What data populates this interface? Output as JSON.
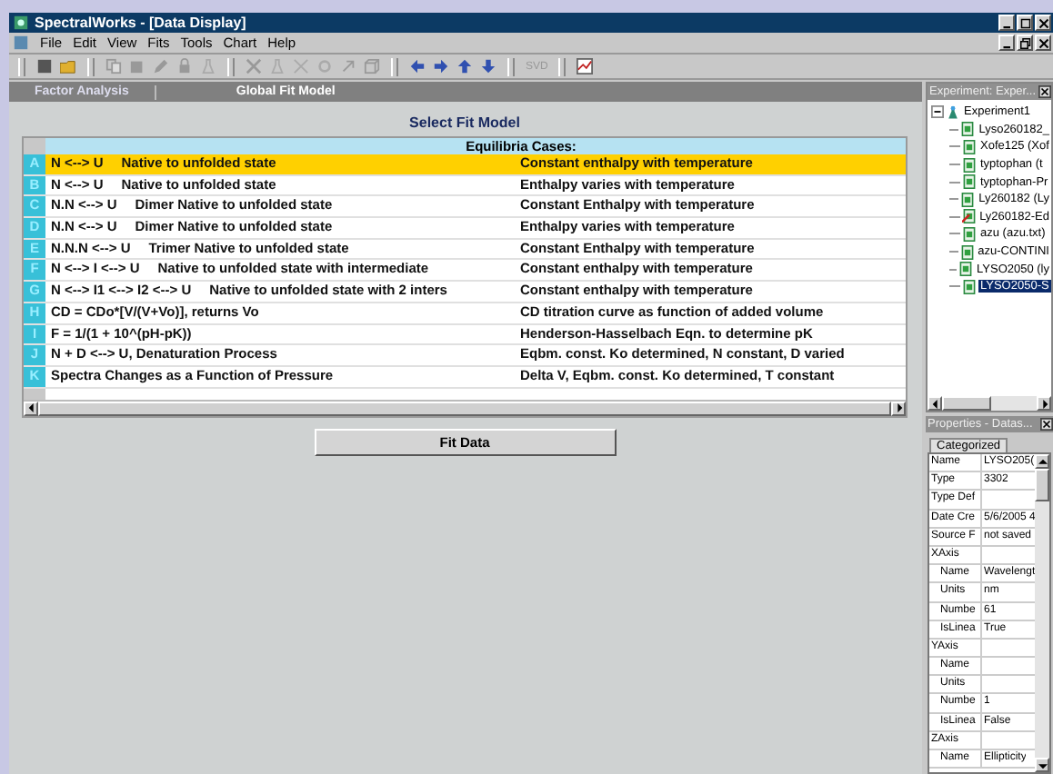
{
  "window": {
    "title": "SpectralWorks - [Data Display]"
  },
  "menu": [
    "File",
    "Edit",
    "View",
    "Fits",
    "Tools",
    "Chart",
    "Help"
  ],
  "toolbar": {
    "zoom_label": "SVD"
  },
  "tabs": [
    "Factor Analysis",
    "Global Fit Model"
  ],
  "main": {
    "heading": "Select Fit Model",
    "table_header": "Equilibria Cases:",
    "rows": [
      {
        "key": "A",
        "model": "N <--> U",
        "description": "Native to unfolded state",
        "condition": "Constant enthalpy with temperature",
        "selected": true
      },
      {
        "key": "B",
        "model": "N <--> U",
        "description": "Native to unfolded state",
        "condition": "Enthalpy varies with temperature",
        "selected": false
      },
      {
        "key": "C",
        "model": "N.N <--> U",
        "description": "Dimer Native to unfolded state",
        "condition": "Constant Enthalpy with temperature",
        "selected": false
      },
      {
        "key": "D",
        "model": "N.N <--> U",
        "description": "Dimer Native to unfolded state",
        "condition": "Enthalpy varies with temperature",
        "selected": false
      },
      {
        "key": "E",
        "model": "N.N.N <--> U",
        "description": "Trimer Native to unfolded state",
        "condition": "Constant Enthalpy with temperature",
        "selected": false
      },
      {
        "key": "F",
        "model": "N <--> I <--> U",
        "description": "Native to unfolded state with intermediate",
        "condition": "Constant enthalpy with temperature",
        "selected": false
      },
      {
        "key": "G",
        "model": "N <--> I1 <--> I2 <--> U",
        "description": "Native to unfolded state with 2 inters",
        "condition": "Constant enthalpy with temperature",
        "selected": false
      },
      {
        "key": "H",
        "model": "CD = CDo*[V/(V+Vo)], returns Vo",
        "condition": "CD titration curve as function of added volume",
        "selected": false
      },
      {
        "key": "I",
        "model": "F = 1/(1 + 10^(pH-pK))",
        "condition": "Henderson-Hasselbach Eqn. to determine pK",
        "selected": false
      },
      {
        "key": "J",
        "model": "N + D <--> U, Denaturation Process",
        "condition": "Eqbm. const. Ko determined, N constant, D varied",
        "selected": false
      },
      {
        "key": "K",
        "model": "Spectra Changes as a Function of Pressure",
        "condition": "Delta V, Eqbm. const. Ko determined, T constant",
        "selected": false
      }
    ],
    "button": "Fit Data"
  },
  "experiment": {
    "title": "Experiment: Exper...",
    "root": "Experiment1",
    "children": [
      {
        "label": "Lyso260182_",
        "flagged": false,
        "selected": false
      },
      {
        "label": "Xofe125 (Xof",
        "flagged": false,
        "selected": false
      },
      {
        "label": "typtophan (t",
        "flagged": false,
        "selected": false
      },
      {
        "label": "typtophan-Pr",
        "flagged": false,
        "selected": false
      },
      {
        "label": "Ly260182 (Ly",
        "flagged": false,
        "selected": false
      },
      {
        "label": "Ly260182-Ed",
        "flagged": true,
        "selected": false
      },
      {
        "label": "azu (azu.txt)",
        "flagged": false,
        "selected": false
      },
      {
        "label": "azu-CONTINI",
        "flagged": false,
        "selected": false
      },
      {
        "label": "LYSO2050 (ly",
        "flagged": false,
        "selected": false
      },
      {
        "label": "LYSO2050-S",
        "flagged": false,
        "selected": true
      }
    ]
  },
  "properties": {
    "title": "Properties - Datas...",
    "tab": "Categorized",
    "rows": [
      {
        "name": "Name",
        "value": "LYSO205("
      },
      {
        "name": "Type",
        "value": "3302"
      },
      {
        "name": "Type Def"
      },
      {
        "name": "Date Cre",
        "value": "5/6/2005 4"
      },
      {
        "name": "Source F",
        "value": "not saved"
      },
      {
        "name": "XAxis",
        "children": [
          {
            "name": "Name",
            "value": "Wavelengt"
          },
          {
            "name": "Units",
            "value": "nm"
          },
          {
            "name": "Numbe",
            "value": "61"
          },
          {
            "name": "IsLinea",
            "value": "True"
          }
        ]
      },
      {
        "name": "YAxis",
        "children": [
          {
            "name": "Name"
          },
          {
            "name": "Units"
          },
          {
            "name": "Numbe",
            "value": "1"
          },
          {
            "name": "IsLinea",
            "value": "False"
          }
        ]
      },
      {
        "name": "ZAxis",
        "children": [
          {
            "name": "Name",
            "value": "Ellipticity"
          }
        ]
      }
    ]
  }
}
